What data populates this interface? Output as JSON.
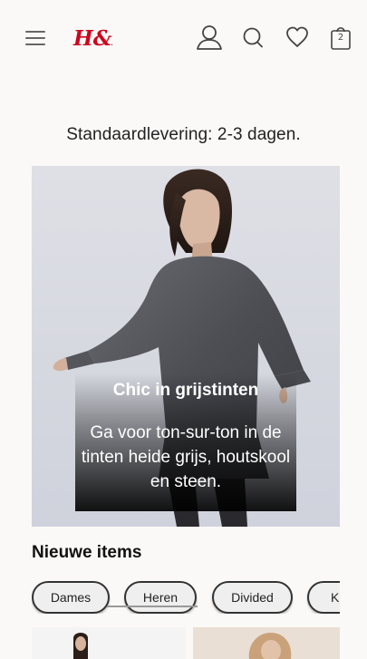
{
  "header": {
    "menu_icon": "hamburger-menu-icon",
    "logo_text": "H&M",
    "brand_color": "#cc071e",
    "icons": [
      "user-icon",
      "search-icon",
      "heart-icon",
      "shopping-bag-icon"
    ],
    "bag_count": "2"
  },
  "delivery_text": "Standaardlevering: 2-3 dagen.",
  "hero": {
    "title": "Chic in grijstinten",
    "text": "Ga voor ton-sur-ton in de tinten heide grijs, houtskool en steen."
  },
  "new_items": {
    "title": "Nieuwe items",
    "categories": [
      "Dames",
      "Heren",
      "Divided",
      "Kinderen"
    ]
  }
}
